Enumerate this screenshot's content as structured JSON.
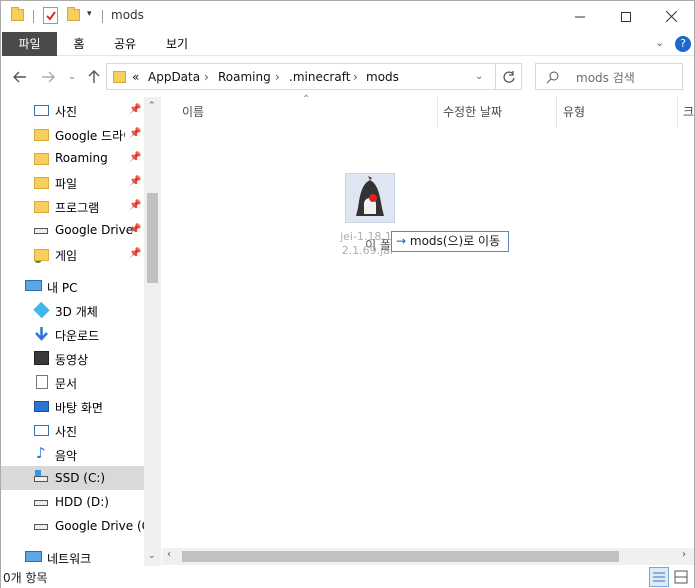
{
  "window": {
    "title": "mods"
  },
  "ribbon": {
    "tabs": [
      "파일",
      "홈",
      "공유",
      "보기"
    ]
  },
  "address": {
    "overflow": "«",
    "path": [
      "AppData",
      "Roaming",
      ".minecraft",
      "mods"
    ]
  },
  "search": {
    "placeholder": "mods 검색"
  },
  "nav": {
    "quick_access": [
      {
        "label": "사진",
        "icon": "pictures-icon",
        "pinned": true
      },
      {
        "label": "Google 드라이",
        "icon": "google-drive-folder-icon",
        "pinned": true
      },
      {
        "label": "Roaming",
        "icon": "folder-icon",
        "pinned": true
      },
      {
        "label": "파일",
        "icon": "folder-icon",
        "pinned": true
      },
      {
        "label": "프로그램",
        "icon": "folder-icon",
        "pinned": true
      },
      {
        "label": "Google Drive",
        "icon": "drive-icon",
        "pinned": true
      },
      {
        "label": "게임",
        "icon": "folder-icon",
        "pinned": true
      }
    ],
    "this_pc": {
      "label": "내 PC",
      "items": [
        {
          "label": "3D 개체",
          "icon": "3d-objects-icon"
        },
        {
          "label": "다운로드",
          "icon": "downloads-icon"
        },
        {
          "label": "동영상",
          "icon": "videos-icon"
        },
        {
          "label": "문서",
          "icon": "documents-icon"
        },
        {
          "label": "바탕 화면",
          "icon": "desktop-icon"
        },
        {
          "label": "사진",
          "icon": "pictures-icon"
        },
        {
          "label": "음악",
          "icon": "music-icon"
        },
        {
          "label": "SSD (C:)",
          "icon": "windows-drive-icon",
          "selected": true
        },
        {
          "label": "HDD (D:)",
          "icon": "drive-icon"
        },
        {
          "label": "Google Drive (G:",
          "icon": "drive-icon"
        }
      ]
    },
    "network": {
      "label": "네트워크"
    }
  },
  "columns": [
    "이름",
    "수정한 날짜",
    "유형",
    "크"
  ],
  "content": {
    "empty_message": "이 폴더는 비어 있습니다.",
    "drag_item_line1": "jei-1.18.1-",
    "drag_item_line2": "2.1.69.jar",
    "drop_tooltip": "mods(으)로 이동",
    "drop_arrow": "→"
  },
  "status": {
    "item_count": "0개 항목"
  },
  "colors": {
    "accent": "#1b5fbf",
    "file_tab": "#4a4a4a",
    "folder": "#f6cf5c"
  }
}
